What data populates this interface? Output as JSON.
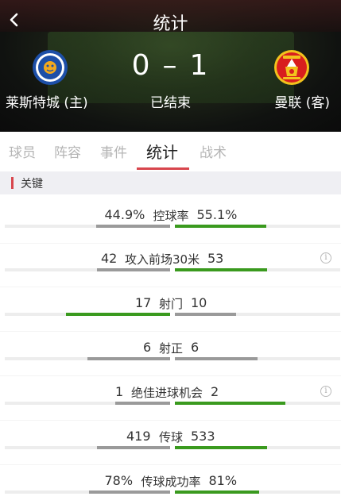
{
  "header": {
    "title": "统计",
    "score_home": "0",
    "score_sep": "–",
    "score_away": "1",
    "status": "已结束",
    "home_team": "莱斯特城 (主)",
    "away_team": "曼联 (客)",
    "home_crest_icon": "leicester-city-crest-icon",
    "away_crest_icon": "manchester-united-crest-icon"
  },
  "tabs": [
    {
      "label": "球员",
      "active": false
    },
    {
      "label": "阵容",
      "active": false
    },
    {
      "label": "事件",
      "active": false
    },
    {
      "label": "统计",
      "active": true
    },
    {
      "label": "战术",
      "active": false
    }
  ],
  "section": {
    "label": "关键"
  },
  "colors": {
    "accent": "#d8464d",
    "winner_bar": "#3a9a1e",
    "loser_bar": "#9a9a9a",
    "track": "#ededed"
  },
  "stats": [
    {
      "name": "控球率",
      "home": "44.9%",
      "away": "55.1%",
      "home_val": 44.9,
      "away_val": 55.1,
      "info": false
    },
    {
      "name": "攻入前场30米",
      "home": "42",
      "away": "53",
      "home_val": 42,
      "away_val": 53,
      "info": true,
      "info_icon": "ⓘ"
    },
    {
      "name": "射门",
      "home": "17",
      "away": "10",
      "home_val": 17,
      "away_val": 10,
      "info": false
    },
    {
      "name": "射正",
      "home": "6",
      "away": "6",
      "home_val": 6,
      "away_val": 6,
      "info": false
    },
    {
      "name": "绝佳进球机会",
      "home": "1",
      "away": "2",
      "home_val": 1,
      "away_val": 2,
      "info": true,
      "info_icon": "ⓘ"
    },
    {
      "name": "传球",
      "home": "419",
      "away": "533",
      "home_val": 419,
      "away_val": 533,
      "info": false
    },
    {
      "name": "传球成功率",
      "home": "78%",
      "away": "81%",
      "home_val": 78,
      "away_val": 81,
      "info": false
    }
  ]
}
